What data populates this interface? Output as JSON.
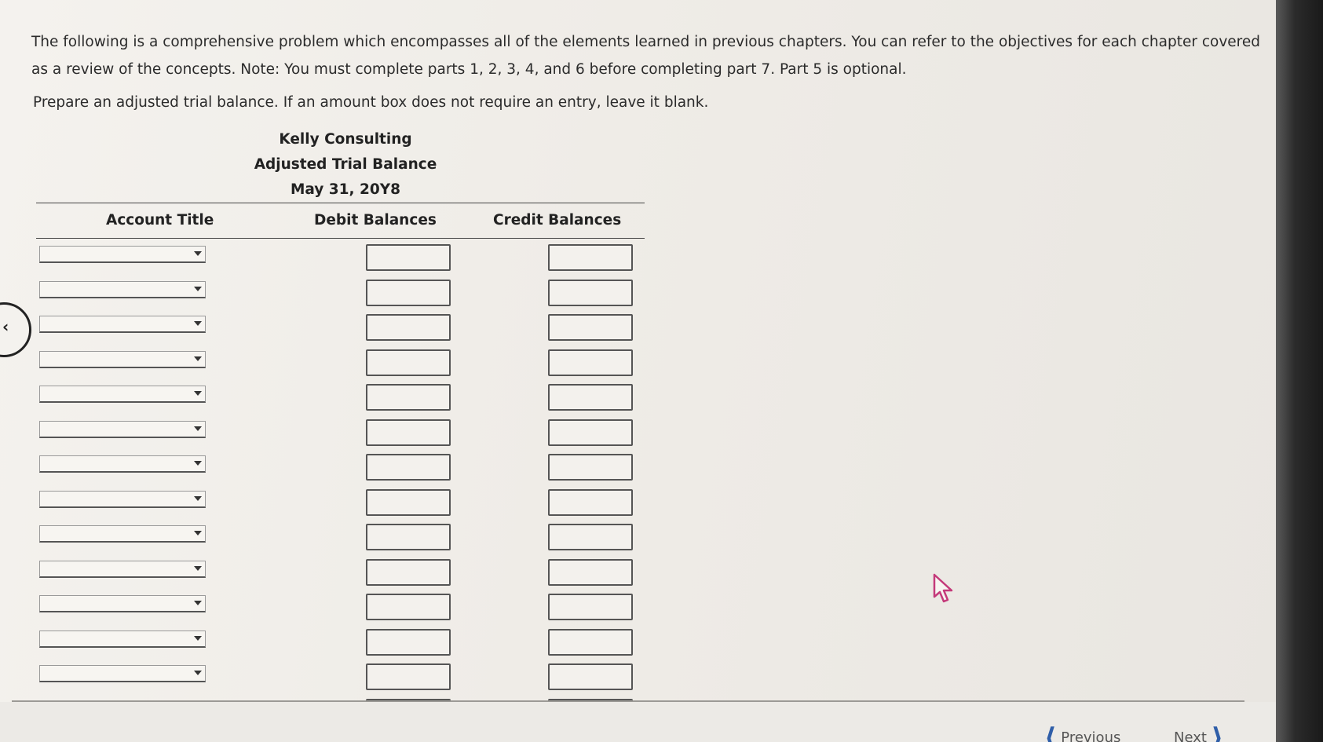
{
  "intro_text": "The following is a comprehensive problem which encompasses all of the elements learned in previous chapters. You can refer to the objectives for each chapter covered as a review of the concepts. Note: You must complete parts 1, 2, 3, 4, and 6 before completing part 7. Part 5 is optional.",
  "instruction_text": "Prepare an adjusted trial balance. If an amount box does not require an entry, leave it blank.",
  "statement": {
    "company": "Kelly Consulting",
    "title": "Adjusted Trial Balance",
    "date": "May 31, 20Y8"
  },
  "columns": {
    "account": "Account Title",
    "debit": "Debit Balances",
    "credit": "Credit Balances"
  },
  "row_count": 14,
  "nav": {
    "previous": "Previous",
    "next": "Next"
  },
  "colors": {
    "accent": "#2f5ea8"
  }
}
